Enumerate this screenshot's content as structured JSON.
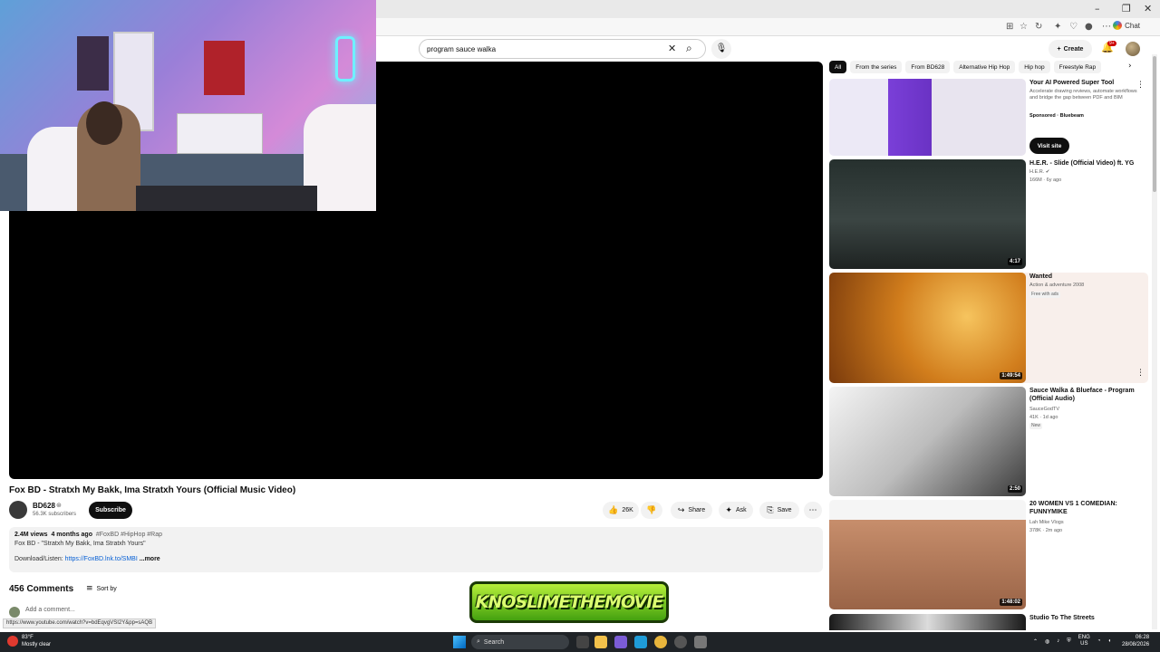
{
  "browser": {
    "chat_label": "Chat",
    "window_controls": {
      "minimize": "–",
      "restore": "❐",
      "close": "✕"
    }
  },
  "header": {
    "search_value": "program sauce walka",
    "create_label": "Create",
    "notifications_badge": "9+"
  },
  "video": {
    "title": "Fox BD - Stratxh My Bakk, Ima Stratxh Yours (Official Music Video)",
    "channel": "BD628",
    "subscribers": "56.3K subscribers",
    "subscribe_label": "Subscribe",
    "likes": "26K",
    "share_label": "Share",
    "ask_label": "Ask",
    "save_label": "Save"
  },
  "description": {
    "views": "2.4M views",
    "age": "4 months ago",
    "tags": "#FoxBD #HipHop #Rap",
    "line1": "Fox BD - \"Stratxh My Bakk, Ima Stratxh Yours\"",
    "download_label": "Download/Listen:",
    "link": "https://FoxBD.lnk.to/SMBI",
    "more_label": "...more"
  },
  "comments": {
    "count": "456 Comments",
    "sort_label": "Sort by",
    "placeholder": "Add a comment..."
  },
  "status_url": "https://www.youtube.com/watch?v=bdEqvgVSI2Y&pp=sAQB",
  "watermark": "KNOSLIMETHEMOVIE",
  "chips": [
    "All",
    "From the series",
    "From BD628",
    "Alternative Hip Hop",
    "Hip hop",
    "Freestyle Rap"
  ],
  "recommendations": [
    {
      "title": "Your AI Powered Super Tool",
      "meta1": "Accelerate drawing reviews, automate workflows and bridge the gap between PDF and BIM",
      "meta2": "Sponsored · Bluebeam",
      "button": "Visit site",
      "duration": ""
    },
    {
      "title": "H.E.R. - Slide (Official Video) ft. YG",
      "meta1": "H.E.R. ✔",
      "meta2": "166M · 6y ago",
      "duration": "4:17"
    },
    {
      "title": "Wanted",
      "meta1": "Action & adventure 2008",
      "meta2": "Free with ads",
      "duration": "1:49:54"
    },
    {
      "title": "Sauce Walka & Blueface - Program (Official Audio)",
      "meta1": "SauceGodTV",
      "meta2": "41K · 1d ago",
      "badge": "New",
      "duration": "2:50"
    },
    {
      "title": "20 WOMEN VS 1 COMEDIAN: FUNNYMIKE",
      "meta1": "Lah Mike Vlogs",
      "meta2": "378K · 2m ago",
      "duration": "1:48:02"
    },
    {
      "title": "Studio To The Streets",
      "meta1": "",
      "meta2": "",
      "duration": ""
    }
  ],
  "taskbar": {
    "temperature": "83°F",
    "weather": "Mostly clear",
    "search_label": "Search",
    "lang1": "ENG",
    "lang2": "US",
    "time": "06:28",
    "date": "28/08/2026"
  }
}
